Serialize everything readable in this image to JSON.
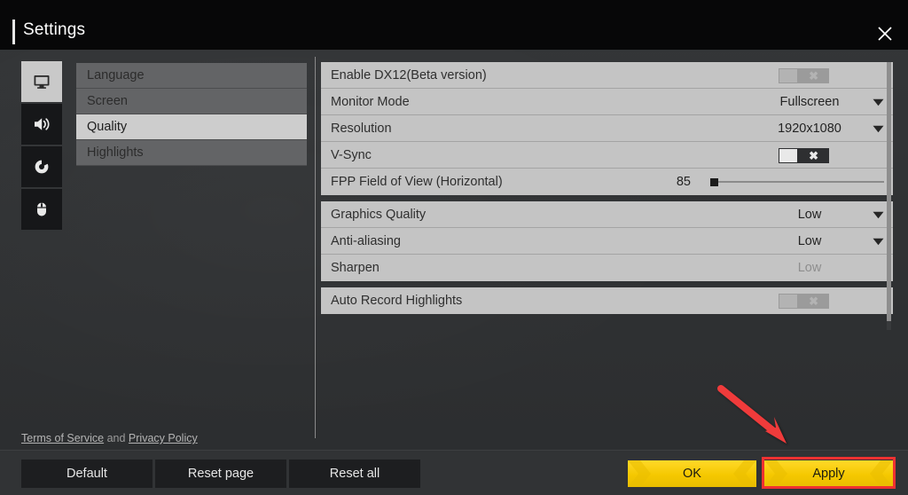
{
  "window": {
    "title": "Settings",
    "close_icon": "close-icon"
  },
  "sidebar": {
    "icons": [
      {
        "name": "monitor-icon",
        "label": "Display",
        "active": true
      },
      {
        "name": "speaker-icon",
        "label": "Audio",
        "active": false
      },
      {
        "name": "gameplay-icon",
        "label": "Gameplay",
        "active": false
      },
      {
        "name": "mouse-icon",
        "label": "Controls",
        "active": false
      }
    ]
  },
  "categories": [
    {
      "label": "Language",
      "active": false
    },
    {
      "label": "Screen",
      "active": false
    },
    {
      "label": "Quality",
      "active": true
    },
    {
      "label": "Highlights",
      "active": false
    }
  ],
  "settings": {
    "group1": [
      {
        "label": "Enable DX12(Beta version)",
        "type": "toggle",
        "state": "off",
        "disabled": true
      },
      {
        "label": "Monitor Mode",
        "type": "dropdown",
        "value": "Fullscreen",
        "disabled": false
      },
      {
        "label": "Resolution",
        "type": "dropdown",
        "value": "1920x1080",
        "disabled": false
      },
      {
        "label": "V-Sync",
        "type": "toggle",
        "state": "off",
        "disabled": false
      },
      {
        "label": "FPP Field of View (Horizontal)",
        "type": "slider",
        "value": "85",
        "percent": 0,
        "disabled": false
      }
    ],
    "group2": [
      {
        "label": "Graphics Quality",
        "type": "dropdown",
        "value": "Low",
        "disabled": false
      },
      {
        "label": "Anti-aliasing",
        "type": "dropdown",
        "value": "Low",
        "disabled": false
      },
      {
        "label": "Sharpen",
        "type": "text",
        "value": "Low",
        "disabled": true
      }
    ],
    "group3": [
      {
        "label": "Auto Record Highlights",
        "type": "toggle",
        "state": "off",
        "disabled": true
      }
    ]
  },
  "legal": {
    "terms_label": "Terms of Service",
    "conjunction": "and",
    "privacy_label": "Privacy Policy"
  },
  "footer": {
    "default_label": "Default",
    "reset_page_label": "Reset page",
    "reset_all_label": "Reset all",
    "ok_label": "OK",
    "apply_label": "Apply"
  },
  "annotation": {
    "highlight_color": "#ef3131",
    "target": "apply-button"
  },
  "colors": {
    "accent_yellow": "#f5c800",
    "panel_row": "#c4c4c4",
    "selected_row": "#cdcdcd",
    "window_bg": "#313335",
    "titlebar_bg": "#070708"
  }
}
